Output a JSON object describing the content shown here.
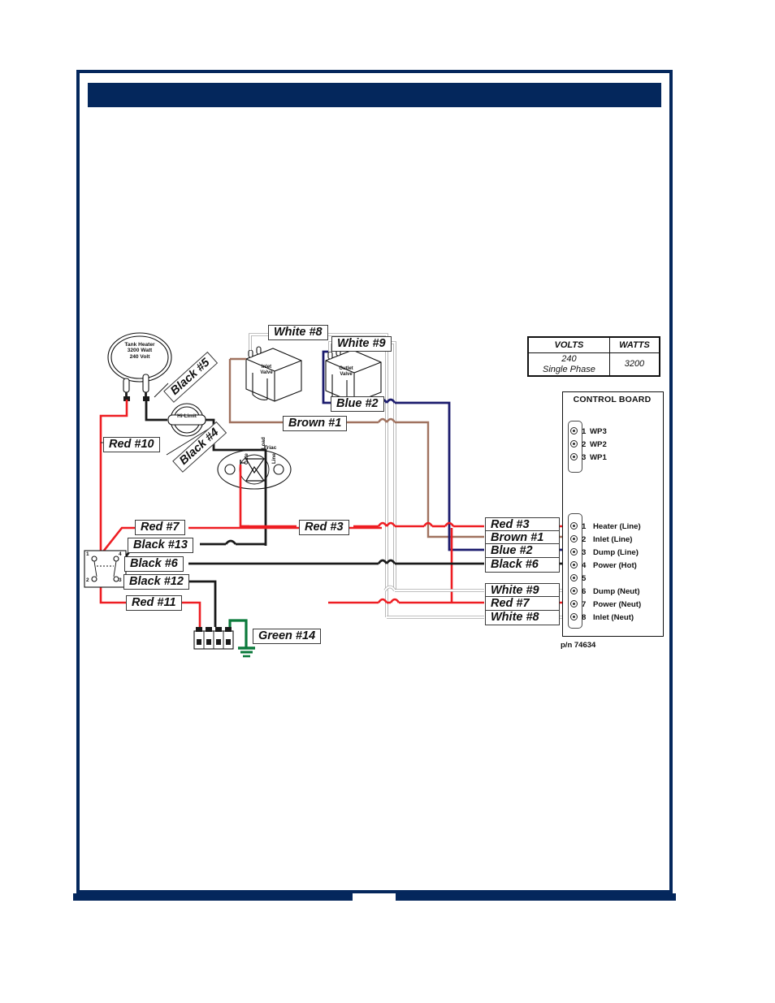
{
  "page": {
    "frame_color": "#04275C",
    "background": "#ffffff",
    "header_bar_color": "#04275C"
  },
  "colors": {
    "red": "#ee1d22",
    "black": "#1a1a1a",
    "brown": "#a0725f",
    "blue": "#1c1c6e",
    "white_wire": "#ffffff",
    "white_wire_outline": "#9a9a9a",
    "green": "#0b7a3b",
    "navy": "#04275C"
  },
  "spec_table": {
    "headers": [
      "VOLTS",
      "WATTS"
    ],
    "rows": [
      {
        "volts": "240\nSingle Phase",
        "volts_line1": "240",
        "volts_line2": "Single Phase",
        "watts": "3200"
      }
    ]
  },
  "control_board": {
    "title": "CONTROL BOARD",
    "part_number": "p/n 74634",
    "top_connector": [
      {
        "num": "1",
        "label": "WP3"
      },
      {
        "num": "2",
        "label": "WP2"
      },
      {
        "num": "3",
        "label": "WP1"
      }
    ],
    "bottom_connector": [
      {
        "num": "1",
        "label": "Heater (Line)",
        "wire": "Red #3",
        "color": "#ee1d22"
      },
      {
        "num": "2",
        "label": "Inlet (Line)",
        "wire": "Brown #1",
        "color": "#a0725f"
      },
      {
        "num": "3",
        "label": "Dump (Line)",
        "wire": "Blue #2",
        "color": "#1c1c6e"
      },
      {
        "num": "4",
        "label": "Power (Hot)",
        "wire": "Black #6",
        "color": "#1a1a1a"
      },
      {
        "num": "5",
        "label": "",
        "wire": "",
        "color": ""
      },
      {
        "num": "6",
        "label": "Dump (Neut)",
        "wire": "White #9",
        "color": "#ffffff"
      },
      {
        "num": "7",
        "label": "Power (Neut)",
        "wire": "Red #7",
        "color": "#ee1d22"
      },
      {
        "num": "8",
        "label": "Inlet (Neut)",
        "wire": "White #8",
        "color": "#ffffff"
      }
    ]
  },
  "components": {
    "tank_heater": {
      "line1": "Tank Heater",
      "line2": "3200 Watt",
      "line3": "240 Volt"
    },
    "hi_limit": {
      "label": "Hi-Limit"
    },
    "inlet_valve": {
      "line1": "Inlet",
      "line2": "Valve"
    },
    "outlet_valve": {
      "line1": "Outlet",
      "line2": "Valve"
    },
    "triac": {
      "label": "Triac",
      "terminals": [
        "Load",
        "Gate",
        "Line"
      ]
    },
    "switch": {
      "terminals": [
        "1",
        "2",
        "3",
        "4"
      ]
    },
    "ground": {
      "label": "Green #14"
    }
  },
  "wire_labels": {
    "white_8_top": "White #8",
    "white_9_top": "White #9",
    "blue_2_top": "Blue #2",
    "brown_1_mid": "Brown #1",
    "black_5": "Black #5",
    "black_4": "Black #4",
    "red_10": "Red #10",
    "red_3_mid": "Red #3",
    "red_7_left": "Red #7",
    "black_13_left": "Black #13",
    "black_6_left": "Black #6",
    "black_12_left": "Black #12",
    "red_11_left": "Red #11",
    "green_14": "Green #14",
    "red_3_right": "Red #3",
    "brown_1_right": "Brown #1",
    "blue_2_right": "Blue #2",
    "black_6_right": "Black #6",
    "white_9_right": "White #9",
    "red_7_right": "Red #7",
    "white_8_right": "White #8"
  }
}
